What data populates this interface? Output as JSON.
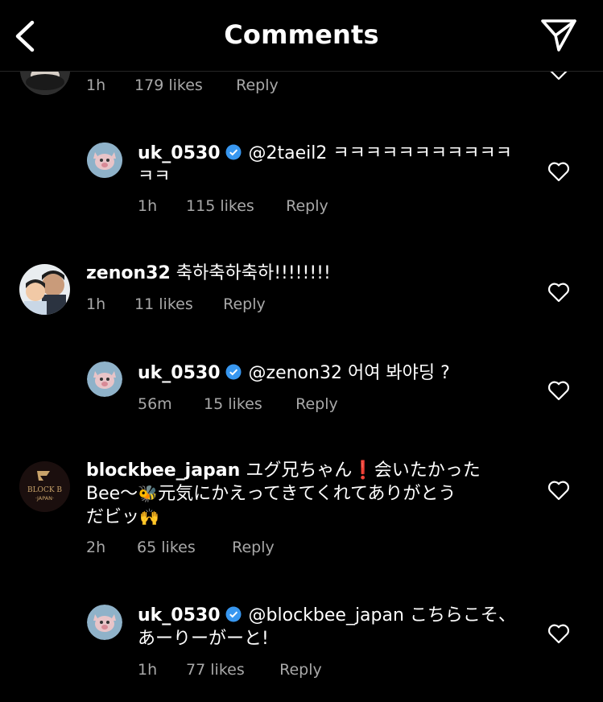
{
  "header": {
    "title": "Comments"
  },
  "comments": [
    {
      "time": "1h",
      "likes": "179 likes",
      "reply": "Reply"
    },
    {
      "user": "uk_0530",
      "text": "@2taeil2 ㅋㅋㅋㅋㅋㅋㅋㅋㅋㅋㅋ ㅋㅋ",
      "time": "1h",
      "likes": "115 likes",
      "reply": "Reply"
    },
    {
      "user": "zenon32",
      "text": "축하축하축하!!!!!!!!",
      "time": "1h",
      "likes": "11 likes",
      "reply": "Reply"
    },
    {
      "user": "uk_0530",
      "text": "@zenon32 어여 봐야딩 ?",
      "time": "56m",
      "likes": "15 likes",
      "reply": "Reply"
    },
    {
      "user": "blockbee_japan",
      "text1": "ユグ兄ちゃん",
      "text2": "会いたかった",
      "line2a": "Bee～",
      "line2b": "元気にかえってきてくれてありがとう",
      "line3": "だビッ",
      "time": "2h",
      "likes": "65 likes",
      "reply": "Reply"
    },
    {
      "user": "uk_0530",
      "text": "@blockbee_japan こちらこそ、あーりーがーと!",
      "time": "1h",
      "likes": "77 likes",
      "reply": "Reply"
    }
  ],
  "avatars": {
    "blockb_logo_text": "BLOCK B",
    "blockb_logo_sub": "·JAPAN·"
  },
  "colors": {
    "background": "#000000",
    "muted": "#a8a8a8",
    "verified": "#3897f0"
  }
}
